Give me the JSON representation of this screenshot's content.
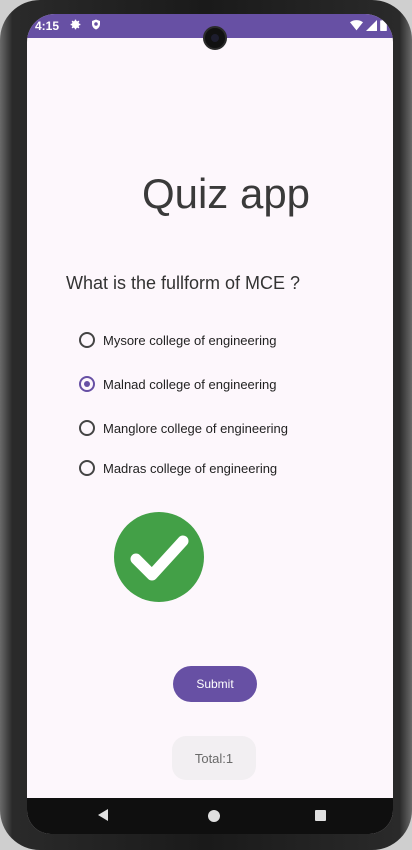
{
  "status_bar": {
    "time": "4:15",
    "icons_left": [
      "gear-icon",
      "shield-icon"
    ],
    "icons_right": [
      "wifi-icon",
      "signal-icon",
      "battery-icon"
    ],
    "background_color": "#6750a4"
  },
  "app": {
    "title": "Quiz app",
    "question": "What is the fullform of MCE ?",
    "options": [
      {
        "label": "Mysore college of engineering",
        "selected": false
      },
      {
        "label": "Malnad college of engineering",
        "selected": true
      },
      {
        "label": "Manglore college of engineering",
        "selected": false
      },
      {
        "label": "Madras college of engineering",
        "selected": false
      }
    ],
    "result_icon": "checkmark-circle-icon",
    "result_color": "#43a047",
    "submit_label": "Submit",
    "total_text": "Total:1",
    "accent_color": "#6750a4"
  },
  "nav_bar": {
    "icons": [
      "back-icon",
      "home-icon",
      "recents-icon"
    ]
  }
}
